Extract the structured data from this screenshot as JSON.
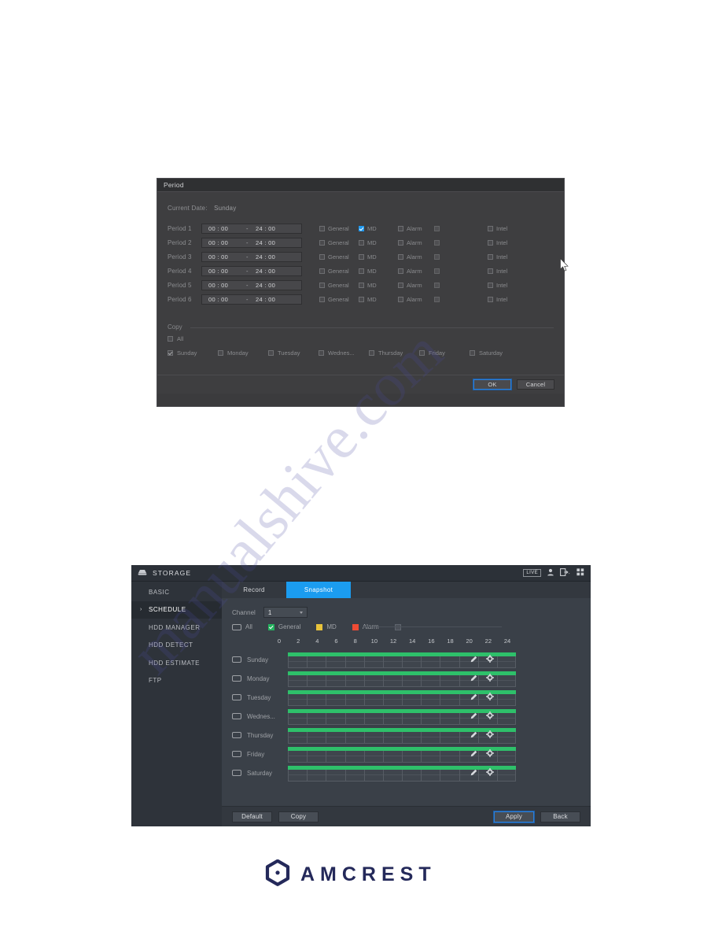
{
  "period_dialog": {
    "title": "Period",
    "current_date_label": "Current Date:",
    "current_date_value": "Sunday",
    "columns": {
      "general": "General",
      "md": "MD",
      "alarm": "Alarm",
      "blank": "",
      "intel": "Intel"
    },
    "periods": [
      {
        "label": "Period 1",
        "start": "00 : 00",
        "dash": "-",
        "end": "24 : 00",
        "general": false,
        "md": true,
        "alarm": false,
        "blank": false,
        "intel": false
      },
      {
        "label": "Period 2",
        "start": "00 : 00",
        "dash": "-",
        "end": "24 : 00",
        "general": false,
        "md": false,
        "alarm": false,
        "blank": false,
        "intel": false
      },
      {
        "label": "Period 3",
        "start": "00 : 00",
        "dash": "-",
        "end": "24 : 00",
        "general": false,
        "md": false,
        "alarm": false,
        "blank": false,
        "intel": false
      },
      {
        "label": "Period 4",
        "start": "00 : 00",
        "dash": "-",
        "end": "24 : 00",
        "general": false,
        "md": false,
        "alarm": false,
        "blank": false,
        "intel": false
      },
      {
        "label": "Period 5",
        "start": "00 : 00",
        "dash": "-",
        "end": "24 : 00",
        "general": false,
        "md": false,
        "alarm": false,
        "blank": false,
        "intel": false
      },
      {
        "label": "Period 6",
        "start": "00 : 00",
        "dash": "-",
        "end": "24 : 00",
        "general": false,
        "md": false,
        "alarm": false,
        "blank": false,
        "intel": false
      }
    ],
    "copy": {
      "section_label": "Copy",
      "all_label": "All",
      "all_checked": false,
      "days": [
        {
          "label": "Sunday",
          "checked": true
        },
        {
          "label": "Monday",
          "checked": false
        },
        {
          "label": "Tuesday",
          "checked": false
        },
        {
          "label": "Wednes...",
          "checked": false
        },
        {
          "label": "Thursday",
          "checked": false
        },
        {
          "label": "Friday",
          "checked": false
        },
        {
          "label": "Saturday",
          "checked": false
        }
      ]
    },
    "buttons": {
      "ok": "OK",
      "cancel": "Cancel"
    }
  },
  "storage_panel": {
    "header": {
      "app_title": "STORAGE",
      "live_label": "LIVE"
    },
    "sidebar": {
      "items": [
        {
          "label": "BASIC",
          "active": false
        },
        {
          "label": "SCHEDULE",
          "active": true
        },
        {
          "label": "HDD MANAGER",
          "active": false
        },
        {
          "label": "HDD DETECT",
          "active": false
        },
        {
          "label": "HDD ESTIMATE",
          "active": false
        },
        {
          "label": "FTP",
          "active": false
        }
      ]
    },
    "tabs": [
      {
        "label": "Record",
        "active": false
      },
      {
        "label": "Snapshot",
        "active": true
      }
    ],
    "channel": {
      "label": "Channel",
      "value": "1"
    },
    "legend": [
      {
        "label": "All",
        "type": "pill",
        "color": ""
      },
      {
        "label": "General",
        "type": "swatch",
        "color": "#24b15e",
        "checked": true
      },
      {
        "label": "MD",
        "type": "swatch",
        "color": "#e8c33b",
        "checked": false
      },
      {
        "label": "Alarm",
        "type": "swatch",
        "color": "#ef4b34",
        "checked": false
      },
      {
        "label": "",
        "type": "swatch",
        "color": "#4b5058",
        "checked": false
      }
    ],
    "axis_ticks": [
      "0",
      "2",
      "4",
      "6",
      "8",
      "10",
      "12",
      "14",
      "16",
      "18",
      "20",
      "22",
      "24"
    ],
    "days": [
      {
        "label": "Sunday",
        "checked": false,
        "bar_color": "#2ec06a",
        "bar_start": 0,
        "bar_end": 24
      },
      {
        "label": "Monday",
        "checked": false,
        "bar_color": "#2ec06a",
        "bar_start": 0,
        "bar_end": 24
      },
      {
        "label": "Tuesday",
        "checked": false,
        "bar_color": "#2ec06a",
        "bar_start": 0,
        "bar_end": 24
      },
      {
        "label": "Wednes...",
        "checked": false,
        "bar_color": "#2ec06a",
        "bar_start": 0,
        "bar_end": 24
      },
      {
        "label": "Thursday",
        "checked": false,
        "bar_color": "#2ec06a",
        "bar_start": 0,
        "bar_end": 24
      },
      {
        "label": "Friday",
        "checked": false,
        "bar_color": "#2ec06a",
        "bar_start": 0,
        "bar_end": 24
      },
      {
        "label": "Saturday",
        "checked": false,
        "bar_color": "#2ec06a",
        "bar_start": 0,
        "bar_end": 24
      }
    ],
    "footer": {
      "default": "Default",
      "copy": "Copy",
      "apply": "Apply",
      "back": "Back"
    }
  },
  "branding": {
    "wordmark": "AMCREST",
    "logo_color": "#24295a"
  },
  "watermark": {
    "text": "manualshive.com"
  }
}
